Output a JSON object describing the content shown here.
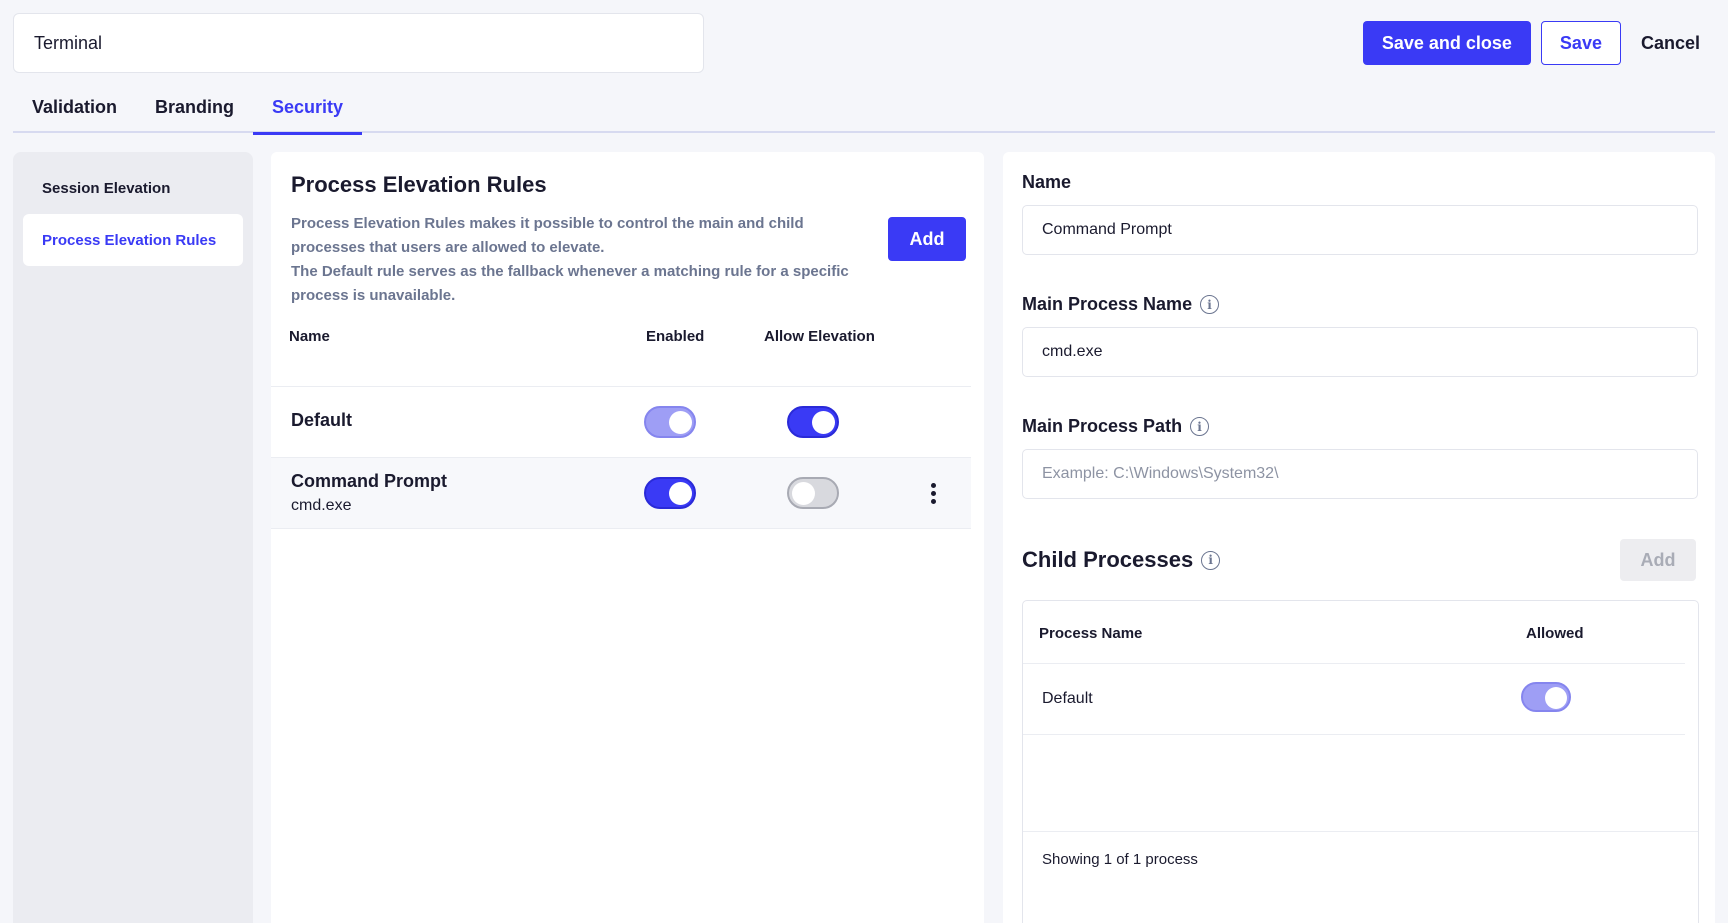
{
  "header": {
    "title_value": "Terminal",
    "save_close_label": "Save and close",
    "save_label": "Save",
    "cancel_label": "Cancel"
  },
  "tabs": [
    {
      "label": "Validation",
      "active": false
    },
    {
      "label": "Branding",
      "active": false
    },
    {
      "label": "Security",
      "active": true
    }
  ],
  "sidebar": {
    "items": [
      {
        "label": "Session Elevation",
        "active": false
      },
      {
        "label": "Process Elevation Rules",
        "active": true
      }
    ]
  },
  "rules_panel": {
    "title": "Process Elevation Rules",
    "description_line1": "Process Elevation Rules makes it possible to control the main and child processes that users are allowed to elevate.",
    "description_line2": "The Default rule serves as the fallback whenever a matching rule for a specific process is unavailable.",
    "add_label": "Add",
    "columns": [
      "Name",
      "Enabled",
      "Allow Elevation"
    ],
    "rows": [
      {
        "name": "Default",
        "process": "",
        "enabled": true,
        "allow_elevation": true,
        "enabled_disabled_style": true
      },
      {
        "name": "Command Prompt",
        "process": "cmd.exe",
        "enabled": true,
        "allow_elevation": false
      }
    ]
  },
  "detail_panel": {
    "name_label": "Name",
    "name_value": "Command Prompt",
    "main_process_name_label": "Main Process Name",
    "main_process_name_value": "cmd.exe",
    "main_process_path_label": "Main Process Path",
    "main_process_path_value": "",
    "main_process_path_placeholder": "Example: C:\\Windows\\System32\\",
    "child_processes_label": "Child Processes",
    "child_add_label": "Add",
    "child_columns": [
      "Process Name",
      "Allowed"
    ],
    "child_rows": [
      {
        "name": "Default",
        "allowed": true
      }
    ],
    "footer": "Showing 1 of 1 process"
  },
  "colors": {
    "accent": "#3a3af5",
    "toggle_light": "#9e9ef5",
    "toggle_off": "#d8d9de"
  }
}
